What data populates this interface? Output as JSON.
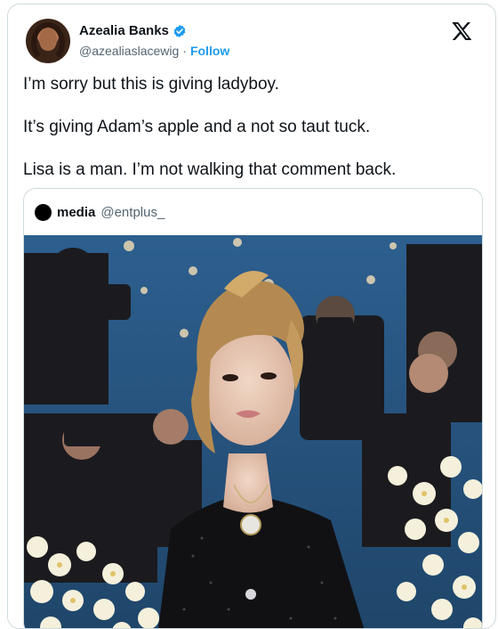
{
  "author": {
    "name": "Azealia Banks",
    "handle": "@azealiaslacewig",
    "separator": "·",
    "follow_label": "Follow"
  },
  "tweet": {
    "paragraphs": [
      "I’m sorry but this is giving ladyboy.",
      "It’s giving Adam’s apple and a not so taut tuck.",
      "Lisa is a man. I’m not walking that comment back."
    ]
  },
  "quoted": {
    "name": "media",
    "handle": "@entplus_"
  },
  "icons": {
    "verified": "verified-badge-icon",
    "platform": "x-logo-icon"
  },
  "colors": {
    "accent": "#1d9bf0",
    "text": "#0f1419",
    "muted": "#536471",
    "border": "#cfd9de"
  }
}
